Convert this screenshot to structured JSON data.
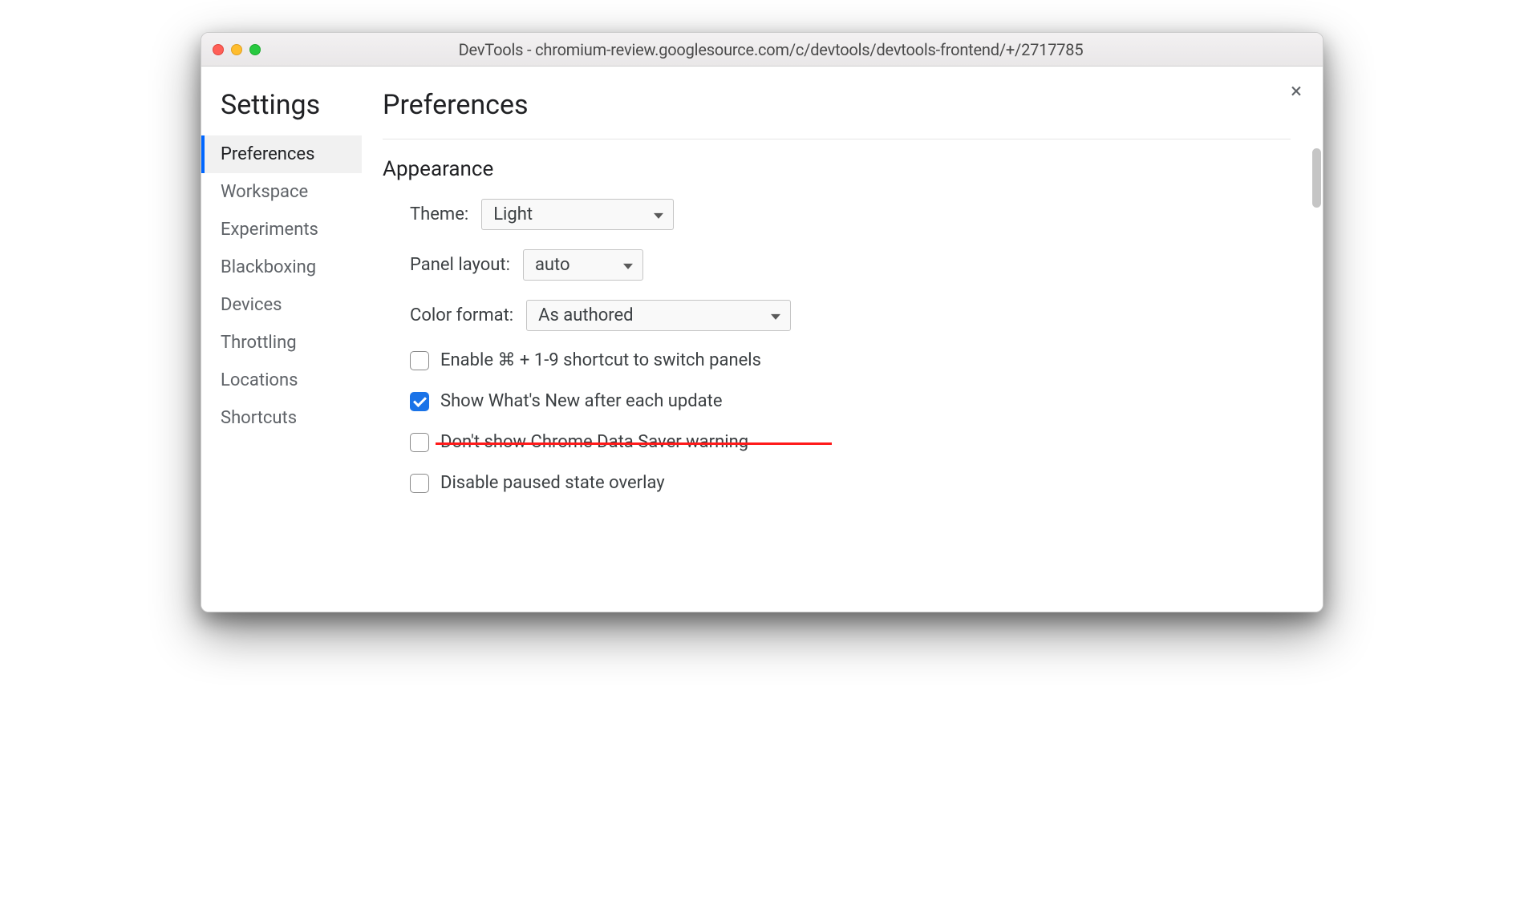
{
  "window": {
    "title": "DevTools - chromium-review.googlesource.com/c/devtools/devtools-frontend/+/2717785"
  },
  "sidebar": {
    "title": "Settings",
    "items": [
      {
        "label": "Preferences",
        "active": true
      },
      {
        "label": "Workspace",
        "active": false
      },
      {
        "label": "Experiments",
        "active": false
      },
      {
        "label": "Blackboxing",
        "active": false
      },
      {
        "label": "Devices",
        "active": false
      },
      {
        "label": "Throttling",
        "active": false
      },
      {
        "label": "Locations",
        "active": false
      },
      {
        "label": "Shortcuts",
        "active": false
      }
    ]
  },
  "main": {
    "title": "Preferences",
    "close_label": "×",
    "appearance": {
      "heading": "Appearance",
      "theme_label": "Theme:",
      "theme_value": "Light",
      "panel_layout_label": "Panel layout:",
      "panel_layout_value": "auto",
      "color_format_label": "Color format:",
      "color_format_value": "As authored",
      "checkboxes": [
        {
          "label": "Enable ⌘ + 1-9 shortcut to switch panels",
          "checked": false,
          "struck": false
        },
        {
          "label": "Show What's New after each update",
          "checked": true,
          "struck": false
        },
        {
          "label": "Don't show Chrome Data Saver warning",
          "checked": false,
          "struck": true
        },
        {
          "label": "Disable paused state overlay",
          "checked": false,
          "struck": false
        }
      ]
    }
  }
}
